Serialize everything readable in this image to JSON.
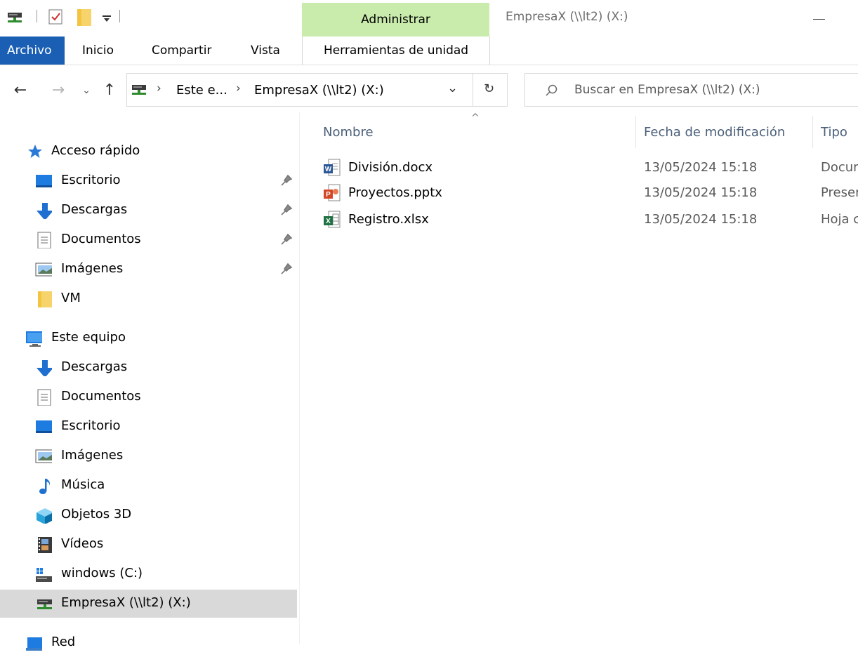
{
  "titlebar": {
    "manage_label": "Administrar",
    "window_title": "EmpresaX (\\\\lt2) (X:)"
  },
  "ribbon": {
    "file_label": "Archivo",
    "tabs": [
      "Inicio",
      "Compartir",
      "Vista"
    ],
    "tools_label": "Herramientas de unidad"
  },
  "nav": {
    "breadcrumb": [
      "Este e...",
      "EmpresaX (\\\\lt2) (X:)"
    ],
    "search_placeholder": "Buscar en EmpresaX (\\\\lt2) (X:)"
  },
  "sidebar": {
    "quick_access": "Acceso rápido",
    "quick_items": [
      "Escritorio",
      "Descargas",
      "Documentos",
      "Imágenes",
      "VM"
    ],
    "this_pc": "Este equipo",
    "pc_items": [
      "Descargas",
      "Documentos",
      "Escritorio",
      "Imágenes",
      "Música",
      "Objetos 3D",
      "Vídeos",
      "windows (C:)",
      "EmpresaX (\\\\lt2) (X:)"
    ],
    "network": "Red"
  },
  "columns": {
    "name": "Nombre",
    "date": "Fecha de modificación",
    "type": "Tipo"
  },
  "files": [
    {
      "name": "División.docx",
      "date": "13/05/2024 15:18",
      "type": "Docur"
    },
    {
      "name": "Proyectos.pptx",
      "date": "13/05/2024 15:18",
      "type": "Preser"
    },
    {
      "name": "Registro.xlsx",
      "date": "13/05/2024 15:18",
      "type": "Hoja c"
    }
  ],
  "colors": {
    "accent": "#1a5fb4",
    "manage_tab": "#c9ecac",
    "selected_row": "#d9d9d9"
  }
}
